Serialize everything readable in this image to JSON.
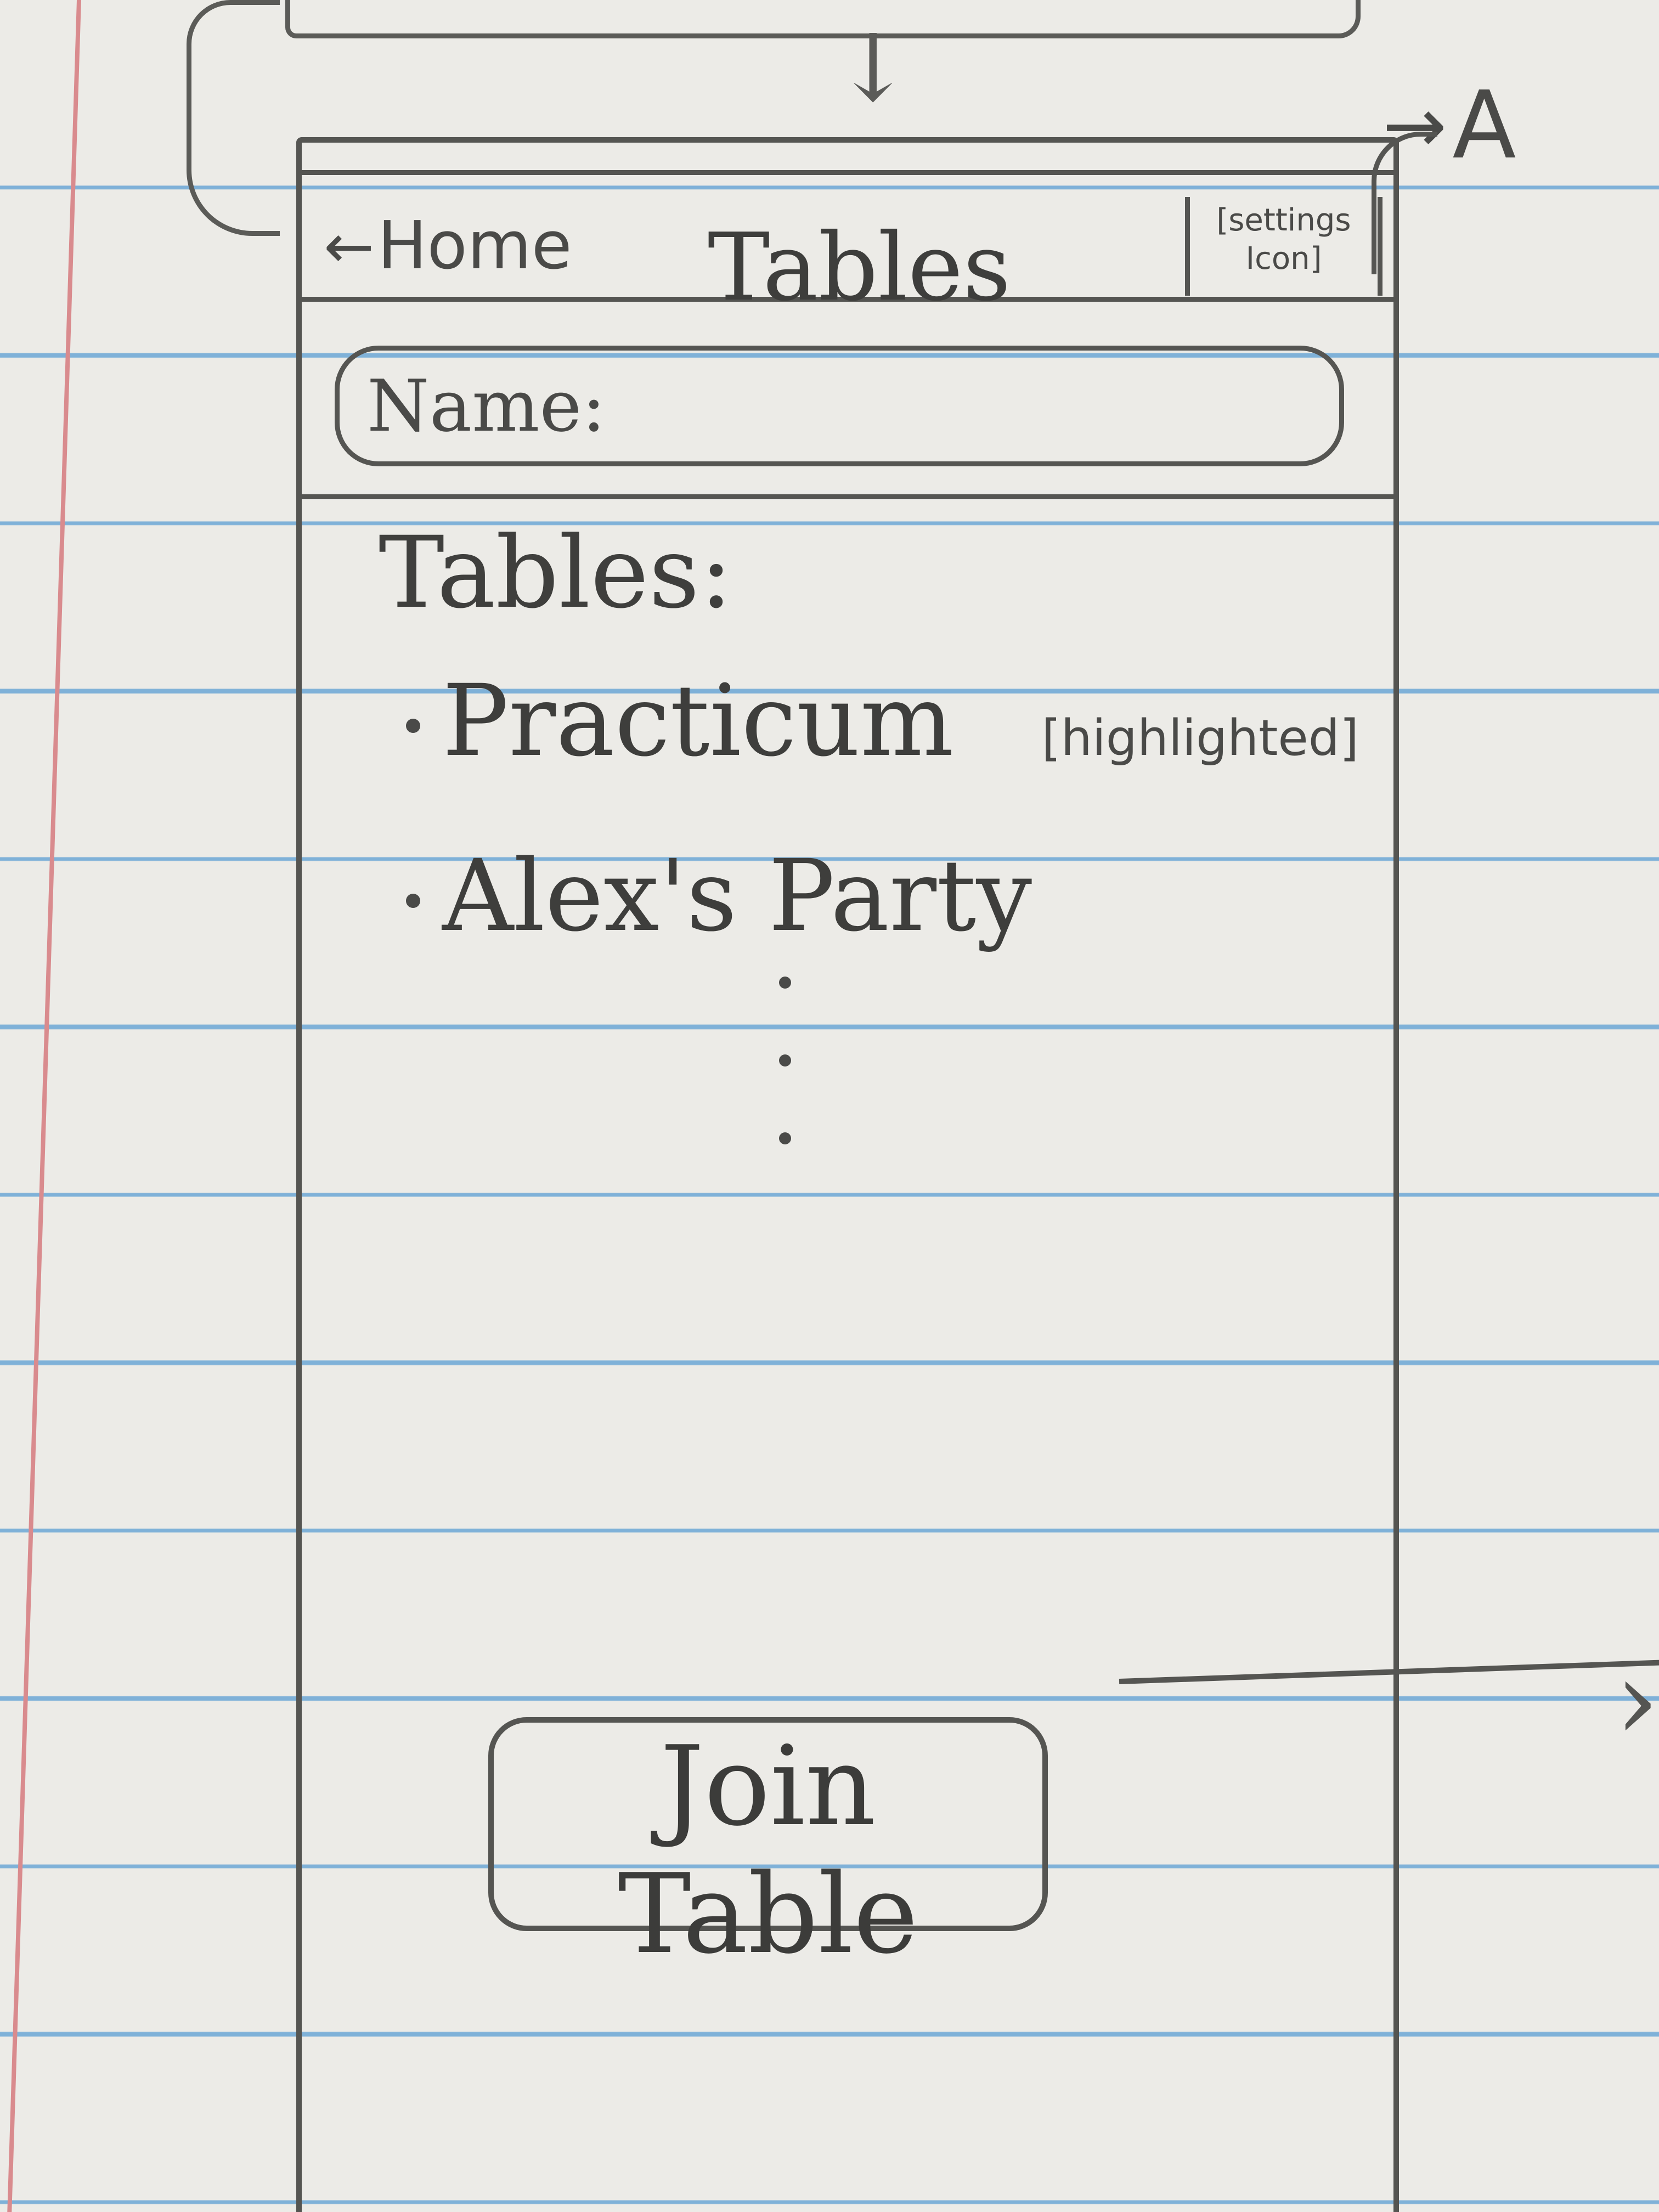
{
  "header": {
    "back_label": "Home",
    "title": "Tables",
    "settings_icon_label": "[settings Icon]"
  },
  "name_field": {
    "label": "Name:"
  },
  "tables": {
    "heading": "Tables:",
    "items": [
      {
        "label": "Practicum",
        "note": "[highlighted]"
      },
      {
        "label": "Alex's Party",
        "note": ""
      }
    ]
  },
  "join_button": {
    "label": "Join Table"
  },
  "navigation": {
    "settings_target": "A"
  }
}
